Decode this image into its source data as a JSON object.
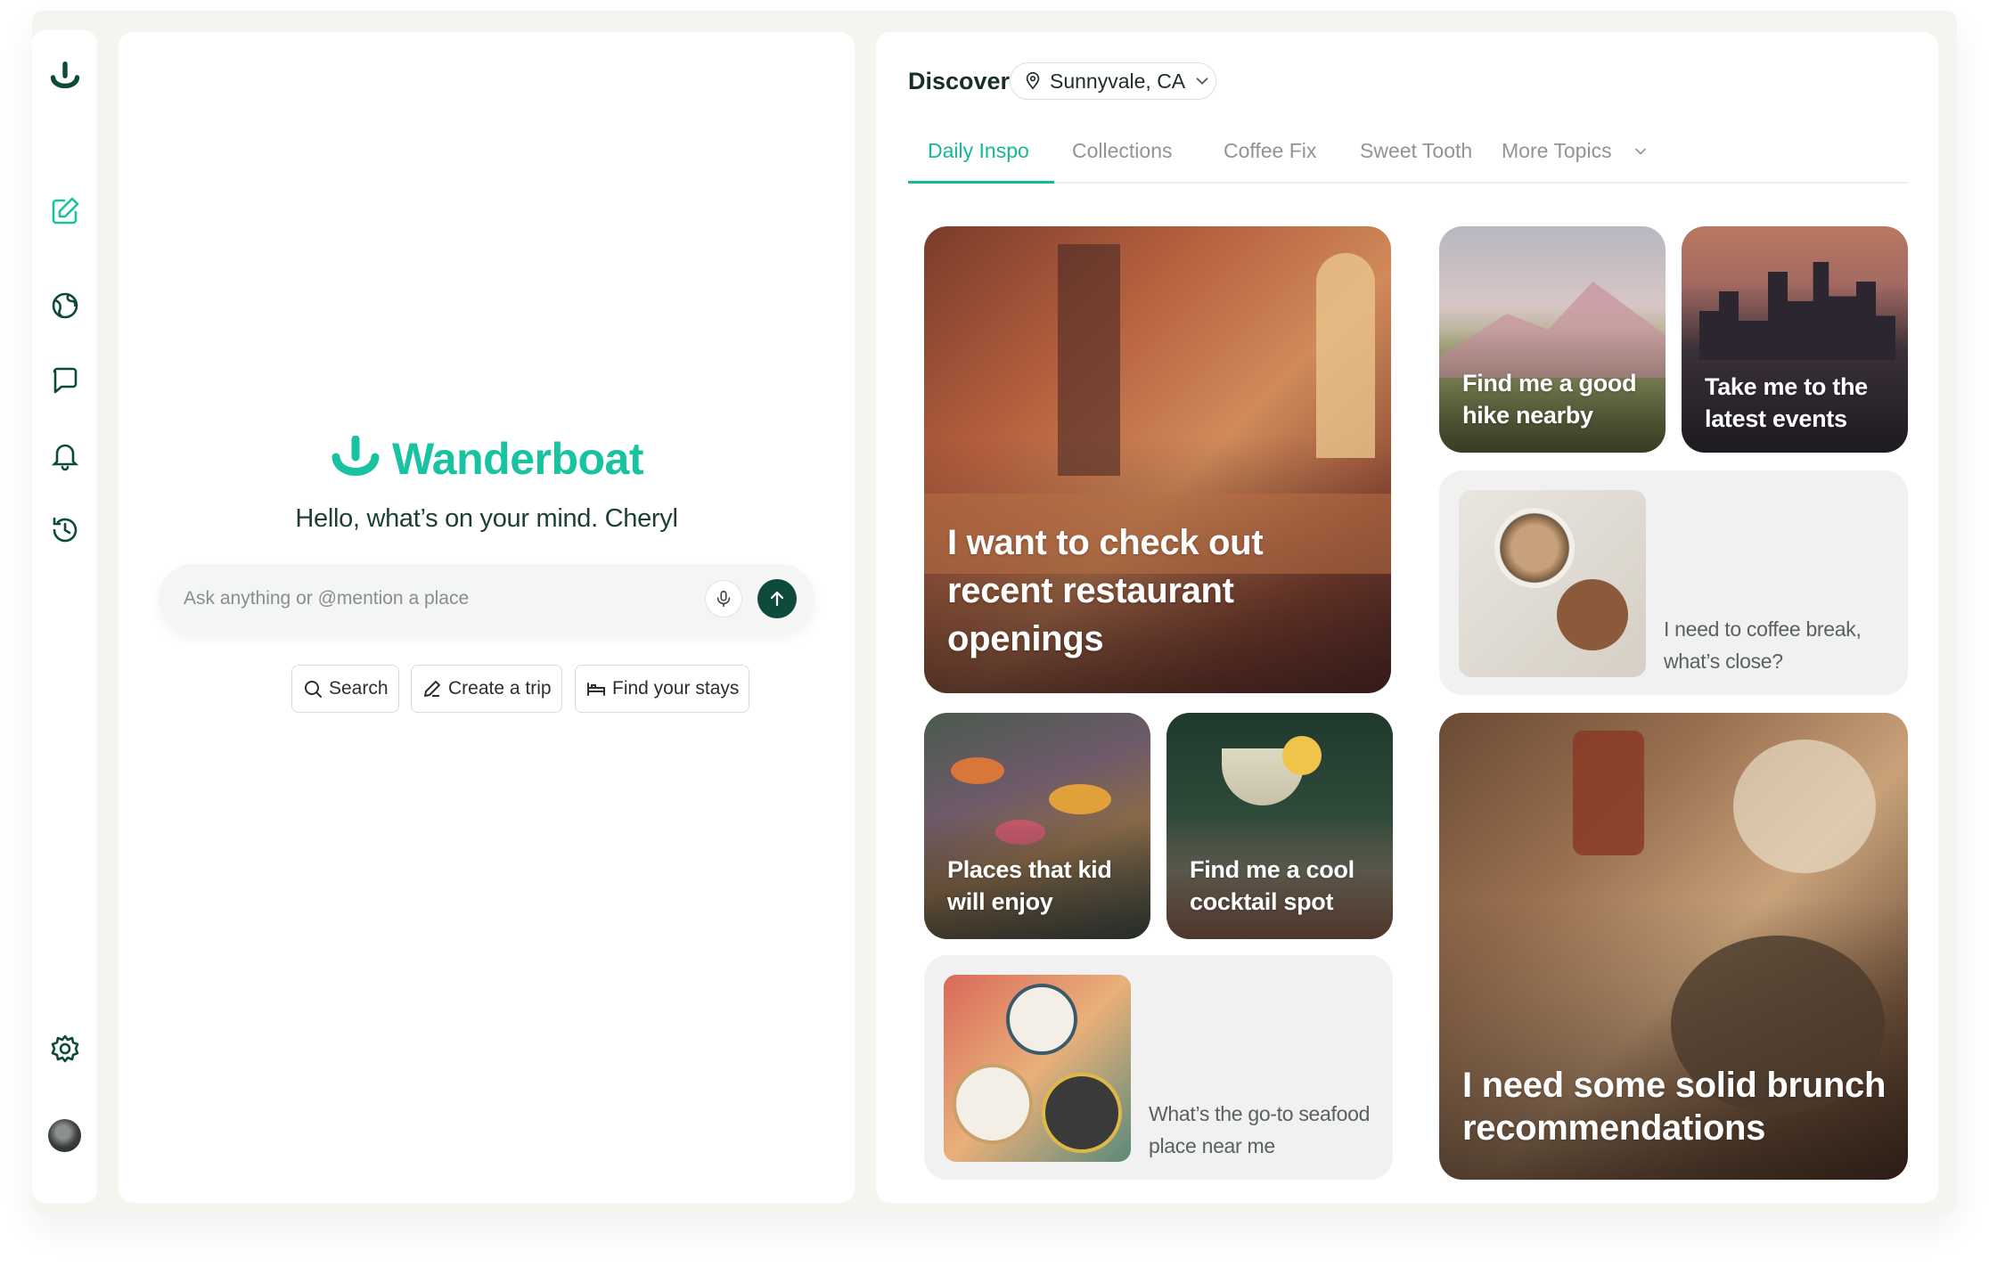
{
  "sidebar": {
    "items": [
      {
        "name": "new-chat",
        "icon": "edit-icon"
      },
      {
        "name": "explore",
        "icon": "globe-icon"
      },
      {
        "name": "chats",
        "icon": "chat-icon"
      },
      {
        "name": "notifications",
        "icon": "bell-icon"
      },
      {
        "name": "history",
        "icon": "history-icon"
      },
      {
        "name": "settings",
        "icon": "gear-icon"
      }
    ]
  },
  "brand": {
    "name": "Wanderboat",
    "color": "#17c3a0"
  },
  "home": {
    "greeting": "Hello, what’s on your mind. Cheryl",
    "ask_placeholder": "Ask anything or @mention a place",
    "chips": [
      "Search",
      "Create a trip",
      "Find your stays"
    ]
  },
  "discover": {
    "title": "Discover",
    "location": "Sunnyvale, CA",
    "tabs": [
      "Daily Inspo",
      "Collections",
      "Coffee Fix",
      "Sweet Tooth",
      "More Topics"
    ],
    "active_tab": "Daily Inspo",
    "accent": "#12b994",
    "cards": [
      {
        "label": "I want to check out recent restaurant openings"
      },
      {
        "label": "Find me a good hike nearby"
      },
      {
        "label": "Take me to the latest events"
      },
      {
        "label": "I need to coffee break, what’s close?"
      },
      {
        "label": "Places that kid will enjoy"
      },
      {
        "label": "Find me a cool cocktail spot"
      },
      {
        "label": "What’s the go-to seafood place near me"
      },
      {
        "label": "I need some solid brunch recommendations"
      }
    ]
  }
}
